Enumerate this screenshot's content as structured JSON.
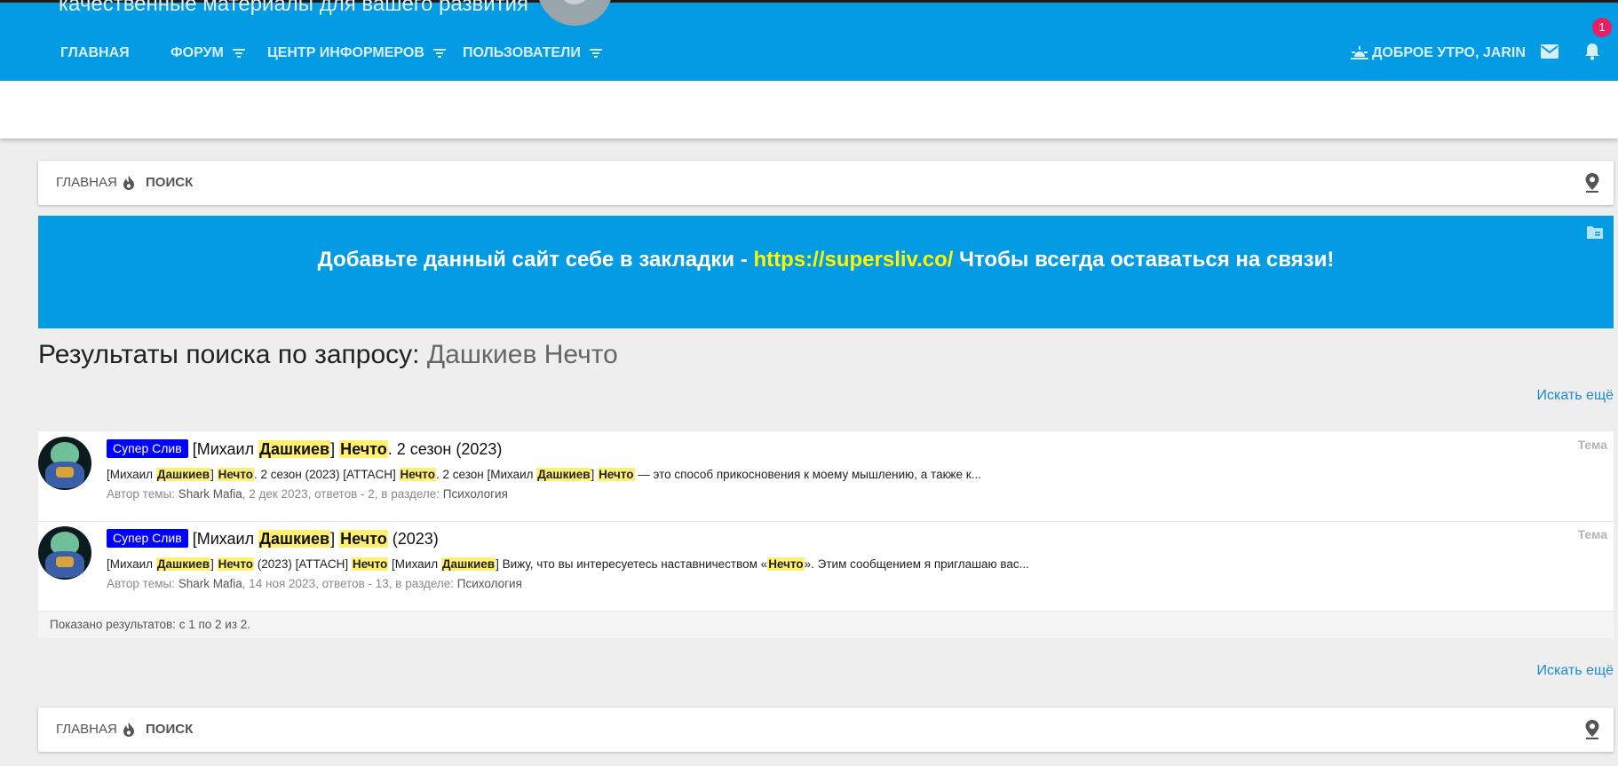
{
  "header": {
    "tagline": "качественные материалы для вашего развития",
    "nav": [
      {
        "label": "ГЛАВНАЯ",
        "has_menu": false
      },
      {
        "label": "ФОРУМ",
        "has_menu": true
      },
      {
        "label": "ЦЕНТР ИНФОРМЕРОВ",
        "has_menu": true
      },
      {
        "label": "ПОЛЬЗОВАТЕЛИ",
        "has_menu": true
      }
    ],
    "greeting": "ДОБРОЕ УТРО, JARIN",
    "notification_count": "1"
  },
  "breadcrumb": {
    "home": "ГЛАВНАЯ",
    "current": "ПОИСК"
  },
  "notice": {
    "text_before": "Добавьте данный сайт себе в закладки - ",
    "link": "https://supersliv.co/",
    "text_after": " Чтобы всегда оставаться на связи!"
  },
  "search": {
    "title_prefix": "Результаты поиска по запросу:",
    "query": "Дашкиев Нечто",
    "more_link": "Искать ещё",
    "results": [
      {
        "label": "Супер Слив",
        "title_parts": [
          {
            "text": "[Михаил ",
            "hl": false
          },
          {
            "text": "Дашкиев",
            "hl": true
          },
          {
            "text": "] ",
            "hl": false
          },
          {
            "text": "Нечто",
            "hl": true
          },
          {
            "text": ". 2 сезон (2023)",
            "hl": false
          }
        ],
        "snippet_parts": [
          {
            "text": "[Михаил ",
            "hl": false
          },
          {
            "text": "Дашкиев",
            "hl": true
          },
          {
            "text": "] ",
            "hl": false
          },
          {
            "text": "Нечто",
            "hl": true
          },
          {
            "text": ". 2 сезон (2023) [ATTACH] ",
            "hl": false
          },
          {
            "text": "Нечто",
            "hl": true
          },
          {
            "text": ". 2 сезон [Михаил ",
            "hl": false
          },
          {
            "text": "Дашкиев",
            "hl": true
          },
          {
            "text": "] ",
            "hl": false
          },
          {
            "text": "Нечто",
            "hl": true
          },
          {
            "text": " — это способ прикосновения к моему мышлению, а также к...",
            "hl": false
          }
        ],
        "meta_prefix": "Автор темы: ",
        "author": "Shark Mafia",
        "meta_middle": ", 2 дек 2023, ответов - 2, в разделе: ",
        "section": "Психология",
        "type": "Тема"
      },
      {
        "label": "Супер Слив",
        "title_parts": [
          {
            "text": "[Михаил ",
            "hl": false
          },
          {
            "text": "Дашкиев",
            "hl": true
          },
          {
            "text": "] ",
            "hl": false
          },
          {
            "text": "Нечто",
            "hl": true
          },
          {
            "text": " (2023)",
            "hl": false
          }
        ],
        "snippet_parts": [
          {
            "text": "[Михаил ",
            "hl": false
          },
          {
            "text": "Дашкиев",
            "hl": true
          },
          {
            "text": "] ",
            "hl": false
          },
          {
            "text": "Нечто",
            "hl": true
          },
          {
            "text": " (2023) [ATTACH] ",
            "hl": false
          },
          {
            "text": "Нечто",
            "hl": true
          },
          {
            "text": " [Михаил ",
            "hl": false
          },
          {
            "text": "Дашкиев",
            "hl": true
          },
          {
            "text": "] Вижу, что вы интересуетесь наставничеством «",
            "hl": false
          },
          {
            "text": "Нечто",
            "hl": true
          },
          {
            "text": "». Этим сообщением я приглашаю вас...",
            "hl": false
          }
        ],
        "meta_prefix": "Автор темы: ",
        "author": "Shark Mafia",
        "meta_middle": ", 14 ноя 2023, ответов - 13, в разделе: ",
        "section": "Психология",
        "type": "Тема"
      }
    ],
    "summary": "Показано результатов: с 1 по 2 из 2."
  },
  "colors": {
    "header_bg": "#049be5",
    "label_bg": "#0000ff",
    "highlight": "#fff071",
    "notice_link": "#fff600",
    "badge": "#e91e63"
  }
}
